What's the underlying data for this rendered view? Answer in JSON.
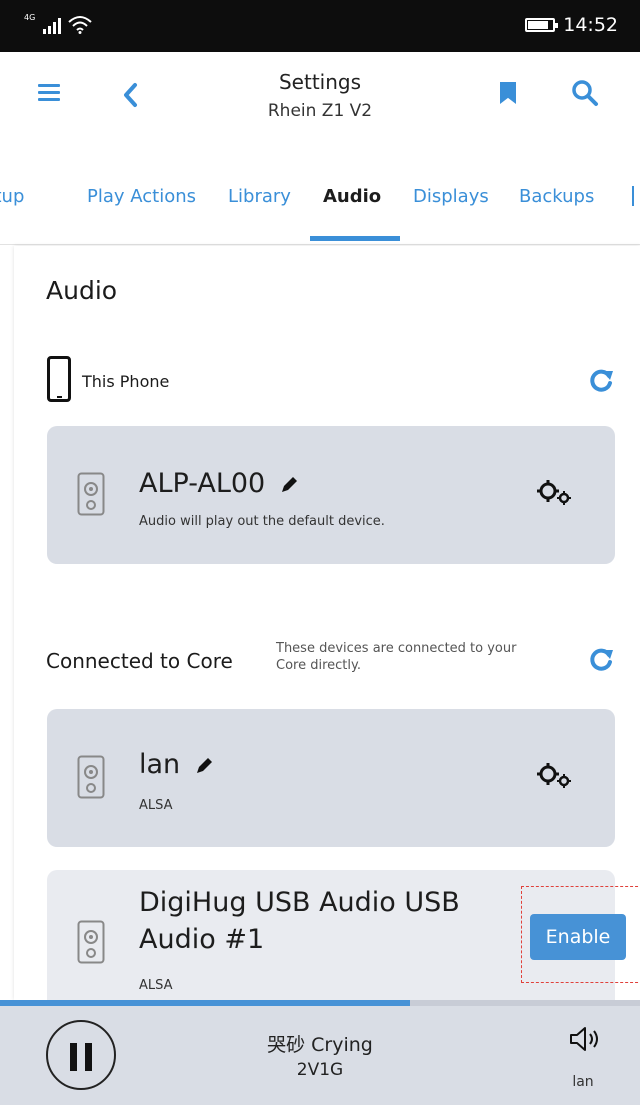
{
  "status_bar": {
    "network": "4G",
    "time": "14:52"
  },
  "header": {
    "title": "Settings",
    "subtitle": "Rhein Z1 V2"
  },
  "tabs": [
    {
      "label": "Setup"
    },
    {
      "label": "Play Actions"
    },
    {
      "label": "Library"
    },
    {
      "label": "Audio",
      "active": true
    },
    {
      "label": "Displays"
    },
    {
      "label": "Backups"
    }
  ],
  "audio": {
    "title": "Audio",
    "this_phone": {
      "label": "This Phone",
      "device": {
        "name": "ALP-AL00",
        "description": "Audio will play out the default device."
      }
    },
    "connected_to_core": {
      "label": "Connected to Core",
      "note": "These devices are connected to your Core directly.",
      "devices": [
        {
          "name": "lan",
          "type": "ALSA"
        },
        {
          "name_line1": "DigiHug USB Audio USB",
          "name_line2": "Audio #1",
          "type": "ALSA",
          "action": "Enable"
        }
      ]
    }
  },
  "now_playing": {
    "title": "哭砂 Crying",
    "artist": "2V1G",
    "zone": "lan",
    "progress": 0.64
  },
  "colors": {
    "accent": "#3a8fd8",
    "card": "#d9dde5",
    "button": "#4792d6"
  },
  "icons": [
    "menu-icon",
    "back-chevron-icon",
    "bookmark-icon",
    "search-icon",
    "phone-icon",
    "refresh-icon",
    "speaker-icon",
    "edit-pencil-icon",
    "settings-gears-icon",
    "pause-icon",
    "volume-icon"
  ]
}
